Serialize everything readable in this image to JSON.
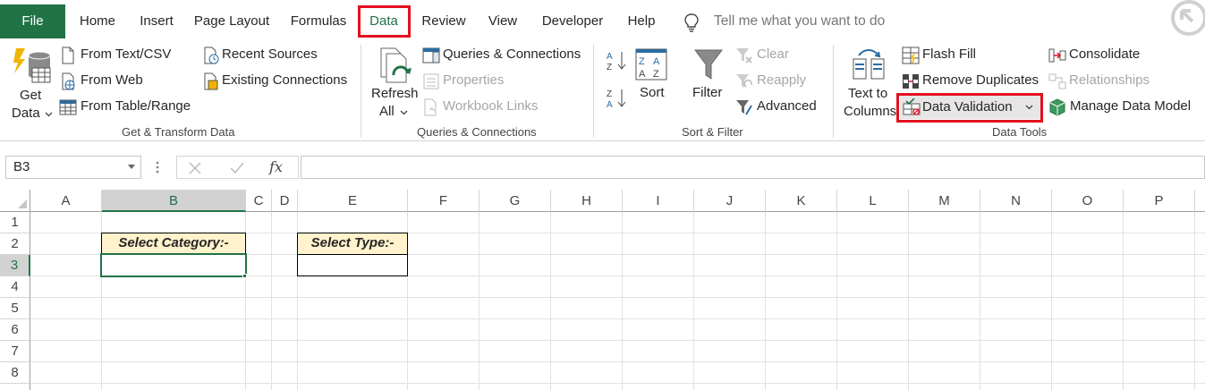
{
  "tabs": {
    "file": "File",
    "home": "Home",
    "insert": "Insert",
    "page_layout": "Page Layout",
    "formulas": "Formulas",
    "data": "Data",
    "review": "Review",
    "view": "View",
    "developer": "Developer",
    "help": "Help"
  },
  "search": {
    "placeholder": "Tell me what you want to do"
  },
  "ribbon": {
    "get_transform": {
      "get_data_line1": "Get",
      "get_data_line2": "Data",
      "from_text_csv": "From Text/CSV",
      "from_web": "From Web",
      "from_table_range": "From Table/Range",
      "recent_sources": "Recent Sources",
      "existing_connections": "Existing Connections",
      "label": "Get & Transform Data"
    },
    "queries": {
      "refresh_line1": "Refresh",
      "refresh_line2": "All",
      "queries_connections": "Queries & Connections",
      "properties": "Properties",
      "workbook_links": "Workbook Links",
      "label": "Queries & Connections"
    },
    "sort_filter": {
      "sort": "Sort",
      "filter": "Filter",
      "clear": "Clear",
      "reapply": "Reapply",
      "advanced": "Advanced",
      "label": "Sort & Filter"
    },
    "data_tools": {
      "text_to_columns_line1": "Text to",
      "text_to_columns_line2": "Columns",
      "flash_fill": "Flash Fill",
      "remove_duplicates": "Remove Duplicates",
      "data_validation": "Data Validation",
      "consolidate": "Consolidate",
      "relationships": "Relationships",
      "manage_data_model": "Manage Data Model",
      "label": "Data Tools"
    }
  },
  "formula_bar": {
    "name_box": "B3",
    "fx": "fx",
    "value": ""
  },
  "grid": {
    "columns": [
      "A",
      "B",
      "C",
      "D",
      "E",
      "F",
      "G",
      "H",
      "I",
      "J",
      "K",
      "L",
      "M",
      "N",
      "O",
      "P"
    ],
    "rows": [
      "1",
      "2",
      "3",
      "4",
      "5",
      "6",
      "7",
      "8"
    ],
    "active_cell": "B3",
    "cells": {
      "B2": "Select Category:-",
      "E2": "Select Type:-"
    }
  },
  "colors": {
    "accent": "#217346",
    "highlight": "#e3101f",
    "label_fill": "#fff2cc"
  }
}
